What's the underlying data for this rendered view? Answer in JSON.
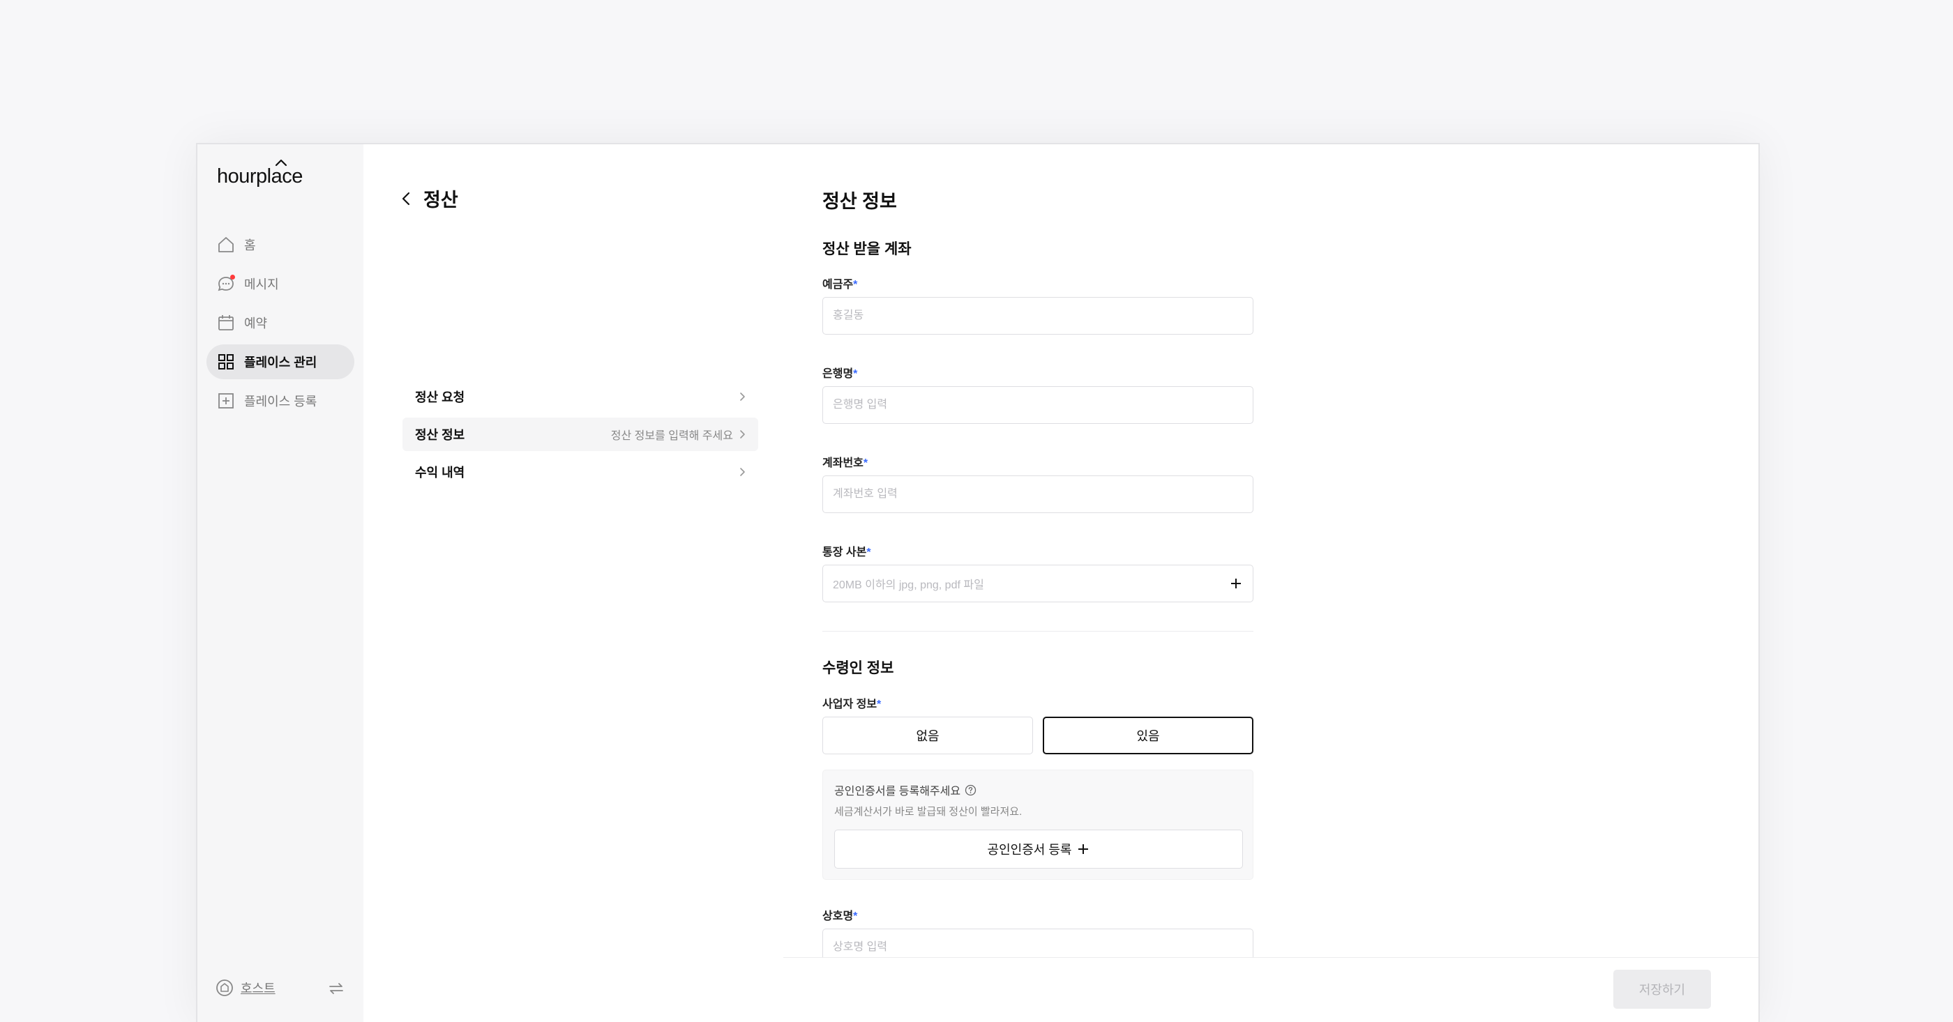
{
  "app": {
    "logo": "hourplace"
  },
  "sidebar": {
    "items": [
      {
        "label": "홈",
        "icon": "home-icon"
      },
      {
        "label": "메시지",
        "icon": "message-icon",
        "has_notification": true
      },
      {
        "label": "예약",
        "icon": "calendar-icon"
      },
      {
        "label": "플레이스 관리",
        "icon": "grid-icon",
        "active": true
      },
      {
        "label": "플레이스 등록",
        "icon": "plus-square-icon"
      }
    ],
    "footer": {
      "label": "호스트",
      "icon": "host-icon",
      "switch_icon": "swap-icon"
    }
  },
  "settlement_menu": {
    "title": "정산",
    "back_icon": "chevron-left-icon",
    "items": [
      {
        "label": "정산 요청",
        "hint": ""
      },
      {
        "label": "정산 정보",
        "hint": "정산 정보를 입력해 주세요",
        "active": true
      },
      {
        "label": "수익 내역",
        "hint": ""
      }
    ]
  },
  "form": {
    "title": "정산 정보",
    "account_section": {
      "title": "정산 받을 계좌",
      "holder": {
        "label": "예금주",
        "required": "*",
        "placeholder": "홍길동",
        "value": ""
      },
      "bank": {
        "label": "은행명",
        "required": "*",
        "placeholder": "은행명 입력",
        "value": ""
      },
      "account_number": {
        "label": "계좌번호",
        "required": "*",
        "placeholder": "계좌번호 입력",
        "value": ""
      },
      "bankbook": {
        "label": "통장 사본",
        "required": "*",
        "placeholder": "20MB 이하의 jpg, png, pdf 파일"
      }
    },
    "recipient_section": {
      "title": "수령인 정보",
      "business_info": {
        "label": "사업자 정보",
        "required": "*",
        "options": [
          "없음",
          "있음"
        ],
        "selected": "있음"
      },
      "certificate": {
        "title": "공인인증서를 등록해주세요",
        "description": "세금계산서가 바로 발급돼 정산이 빨라져요.",
        "button": "공인인증서 등록"
      },
      "company_name": {
        "label": "상호명",
        "required": "*",
        "placeholder": "상호명 입력",
        "value": ""
      }
    },
    "save_label": "저장하기"
  },
  "colors": {
    "accent_required": "#3a6bff",
    "notification": "#ff3b3b",
    "active_nav_bg": "#e6e6e8"
  }
}
